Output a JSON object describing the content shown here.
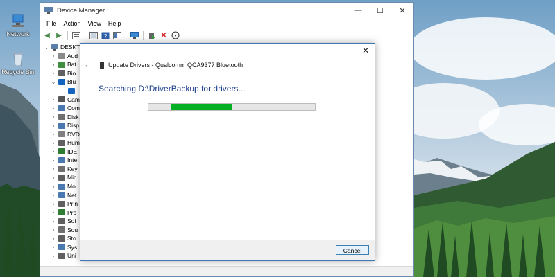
{
  "desktop": {
    "icons": [
      {
        "label": "Network",
        "icon": "network-icon"
      },
      {
        "label": "Recycle Bin",
        "icon": "recycle-bin-icon"
      }
    ]
  },
  "device_manager": {
    "title": "Device Manager",
    "window_controls": {
      "minimize": "—",
      "maximize": "☐",
      "close": "✕"
    },
    "menu": [
      "File",
      "Action",
      "View",
      "Help"
    ],
    "toolbar_icons": [
      "back-icon",
      "forward-icon",
      "properties-icon",
      "refresh-icon",
      "help-icon",
      "monitor-icon",
      "update-driver-icon",
      "uninstall-icon",
      "download-icon"
    ],
    "tree_root": "DESKTOP",
    "tree_items": [
      {
        "label": "Aud",
        "exp": "›",
        "color": "#8a8a8a"
      },
      {
        "label": "Bat",
        "exp": "›",
        "color": "#3e8e3e"
      },
      {
        "label": "Bio",
        "exp": "›",
        "color": "#606060"
      },
      {
        "label": "Blu",
        "exp": "⌄",
        "color": "#1565c0"
      },
      {
        "label": "",
        "exp": "",
        "color": "#1565c0"
      },
      {
        "label": "Cam",
        "exp": "›",
        "color": "#555555"
      },
      {
        "label": "Com",
        "exp": "›",
        "color": "#4a78b0"
      },
      {
        "label": "Disk",
        "exp": "›",
        "color": "#707070"
      },
      {
        "label": "Disp",
        "exp": "›",
        "color": "#4a78b0"
      },
      {
        "label": "DVD",
        "exp": "›",
        "color": "#808080"
      },
      {
        "label": "Hum",
        "exp": "›",
        "color": "#606060"
      },
      {
        "label": "IDE",
        "exp": "›",
        "color": "#2e7d32"
      },
      {
        "label": "Inte",
        "exp": "›",
        "color": "#4a78b0"
      },
      {
        "label": "Key",
        "exp": "›",
        "color": "#707070"
      },
      {
        "label": "Mic",
        "exp": "›",
        "color": "#606060"
      },
      {
        "label": "Mo",
        "exp": "›",
        "color": "#4a78b0"
      },
      {
        "label": "Net",
        "exp": "›",
        "color": "#4a78b0"
      },
      {
        "label": "Prin",
        "exp": "›",
        "color": "#606060"
      },
      {
        "label": "Pro",
        "exp": "›",
        "color": "#2e7d32"
      },
      {
        "label": "Sof",
        "exp": "›",
        "color": "#606060"
      },
      {
        "label": "Sou",
        "exp": "›",
        "color": "#707070"
      },
      {
        "label": "Sto",
        "exp": "›",
        "color": "#606060"
      },
      {
        "label": "Sys",
        "exp": "›",
        "color": "#4a78b0"
      },
      {
        "label": "Uni",
        "exp": "›",
        "color": "#606060"
      }
    ]
  },
  "dialog": {
    "title": "Update Drivers - Qualcomm QCA9377 Bluetooth",
    "status": "Searching D:\\DriverBackup for drivers...",
    "progress": {
      "start": 0.135,
      "end": 0.5,
      "color": "#06b025"
    },
    "cancel_label": "Cancel",
    "close_glyph": "✕",
    "back_glyph": "←"
  }
}
